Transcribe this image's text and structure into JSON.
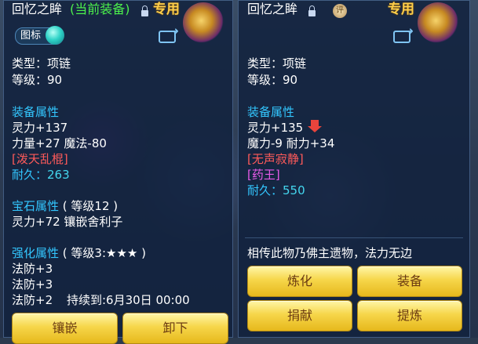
{
  "left": {
    "title": "回忆之眸",
    "current_equipped": "(当前装备)",
    "special_badge": "专用",
    "tag_label": "图标",
    "type": "类型：项链",
    "level": "等级：90",
    "equip_attr_title": "装备属性",
    "attr1": "灵力+137",
    "attr2": "力量+27 魔法-80",
    "special_skill": "[泼天乱棍]",
    "durability_label": "耐久：",
    "durability_value": "263",
    "gem_title": "宝石属性",
    "gem_level": "( 等级12 )",
    "gem_effect": "灵力+72 镶嵌舍利子",
    "enhance_title": "强化属性",
    "enhance_level": "( 等级3:★★★ )",
    "enhance1": "法防+3",
    "enhance2": "法防+3",
    "enhance3": "法防+2",
    "enhance_duration": "持续到:6月30日 00:00",
    "buttons": {
      "inlay": "镶嵌",
      "unequip": "卸下"
    }
  },
  "right": {
    "title": "回忆之眸",
    "special_badge": "专用",
    "medal_char": "评",
    "type": "类型：项链",
    "level": "等级：90",
    "equip_attr_title": "装备属性",
    "attr1": "灵力+135",
    "attr2": "魔力-9 耐力+34",
    "special_skill": "[无声寂静]",
    "special_effect": "[药王]",
    "durability_label": "耐久：",
    "durability_value": "550",
    "description": "相传此物乃佛主遗物，法力无边",
    "buttons": {
      "refine": "炼化",
      "equip": "装备",
      "donate": "捐献",
      "extract": "提炼"
    }
  }
}
